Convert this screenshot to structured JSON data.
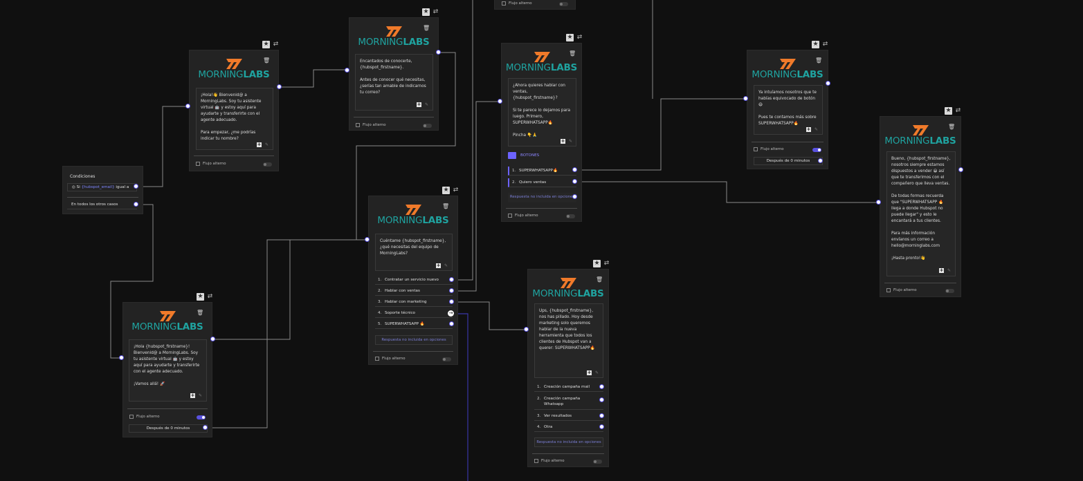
{
  "logo": {
    "part1": "MORNING",
    "part2": "LABS"
  },
  "flow_alt_label": "Flujo alterno",
  "no_option_label": "Respuesta no incluida en opciones",
  "conditions": {
    "title": "Condiciones",
    "row1_prefix": "Si",
    "row1_var": "{hubspot_email}",
    "row1_rest": "igual a",
    "row2": "En todos los otros casos"
  },
  "node_hola": {
    "message": "¡Hola!👋 Bienvenid@ a MorningLabs. Soy tu asistente virtual 🤖 y estoy aquí para ayudarte y transferirte con el agente adecuado.\n\nPara empezar, ¿me podrías indicar tu nombre?"
  },
  "node_encantados": {
    "message": "Encantados de conocerte, {hubspot_firstname}.\n\nAntes de conocer qué necesitas, ¿serías tan amable de indicarnos tu correo?"
  },
  "node_hola2": {
    "message": "¡Hola {hubspot_firstname}! Bienvenid@ a MorningLabs. Soy tu asistente virtual 🤖 y estoy aquí para ayudarte y transferirte con el agente adecuado.\n\n¡Vamos allá! 🚀",
    "after": "Después de 0 minutos"
  },
  "node_cuentame": {
    "message": "Cuéntame {hubspot_firstname}, ¿qué necesitas del equipo de MorningLabs?",
    "options": [
      {
        "n": "1.",
        "label": "Contratar un servicio nuevo"
      },
      {
        "n": "2.",
        "label": "Hablar con ventas"
      },
      {
        "n": "3.",
        "label": "Hablar con marketing"
      },
      {
        "n": "4.",
        "label": "Soporte técnico"
      },
      {
        "n": "5.",
        "label": "SUPERWHATSAPP 🔥"
      }
    ]
  },
  "node_ventas": {
    "message": "¿Ahora quieres hablar con ventas, {hubspot_firstname}?\n\nSi te parece lo dejamos para luego. Primero, SUPERWHATSAPP🔥\n\nPincha 👇🙏",
    "buttons_title": "BOTONES",
    "options": [
      {
        "n": "1.",
        "label": "SUPERWHATSAPP🔥"
      },
      {
        "n": "2.",
        "label": "Quiero ventas"
      }
    ]
  },
  "node_ups": {
    "message": "Ups, {hubspot_firstname}, nos has pillado. Hoy desde marketing solo queremos hablar de la nueva herramienta que todos los clientes de Hubspot van a querer: SUPERWHATSAPP🔥",
    "options": [
      {
        "n": "1.",
        "label": "Creación campaña mail"
      },
      {
        "n": "2.",
        "label": "Creación campaña Whatsapp"
      },
      {
        "n": "3.",
        "label": "Ver resultados"
      },
      {
        "n": "4.",
        "label": "Otra"
      }
    ]
  },
  "node_intuiamos": {
    "message": "Ya intuíamos nosotros que te habías equivocado de botón😄\n\nPues te contamos más sobre SUPERWHATSAPP🔥",
    "after": "Después de 0 minutos"
  },
  "node_bueno": {
    "message": "Bueno, {hubspot_firstname}, nosotros siempre estamos dispuestos a vender 😀 así que te transferimos con el compañero que lleva ventas.\n\nDe todas formas recuerda que \"SUPERWHATSAPP 🔥 llega a donde Hubspot no puede llegar\" y esto le encantará a tus clientes.\n\nPara más información envíanos un correo a hello@morninglabs.com\n\n¡Hasta pronto!👋"
  },
  "colors": {
    "accent": "#5b54e6",
    "brand_teal": "#1fa3a0",
    "brand_orange": "#f07a2a",
    "background": "#101010"
  }
}
